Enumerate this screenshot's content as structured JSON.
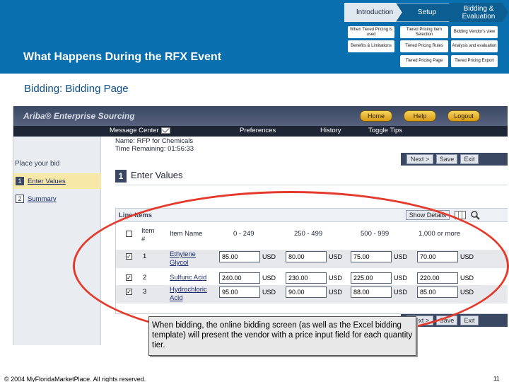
{
  "header": {
    "title": "What Happens During the RFX Event",
    "nav": {
      "stages": [
        {
          "label": "Introduction"
        },
        {
          "label": "Setup"
        },
        {
          "label": "Bidding & Evaluation"
        }
      ],
      "sub_items": {
        "introduction": [
          "When Tiered Pricing is used",
          "Benefits & Limitations"
        ],
        "setup": [
          "Tiered Pricing Item Selection",
          "Tiered Pricing Rules",
          "Tiered Pricing Page"
        ],
        "bidding": [
          "Bidding Vendor's view",
          "Analysis and evaluation",
          "Tiered Pricing Export"
        ]
      }
    }
  },
  "subtitle": "Bidding: Bidding Page",
  "app": {
    "logo": "Ariba® Enterprise Sourcing",
    "top_buttons": [
      "Home",
      "Help",
      "Logout"
    ],
    "menu": {
      "message_center": "Message Center",
      "preferences": "Preferences",
      "history": "History",
      "toggle_tips": "Toggle Tips"
    },
    "event_name": "Name: RFP for Chemicals",
    "time_remaining": "Time Remaining: 01:56:33",
    "left_nav": {
      "heading": "Place your bid",
      "steps": [
        {
          "num": "1",
          "label": "Enter Values"
        },
        {
          "num": "2",
          "label": "Summary"
        }
      ]
    },
    "toolbar": {
      "next": "Next >",
      "save": "Save",
      "exit": "Exit"
    },
    "step_header": {
      "num": "1",
      "title": "Enter Values"
    },
    "line_items": {
      "title": "Line Items",
      "show_details": "Show Details",
      "columns": [
        "Item #",
        "Item Name",
        "0 - 249",
        "250 - 499",
        "500 - 999",
        "1,000 or more"
      ],
      "currency": "USD",
      "rows": [
        {
          "num": "1",
          "name": "Ethylene Glycol",
          "prices": [
            "85.00",
            "80.00",
            "75.00",
            "70.00"
          ],
          "checked": true
        },
        {
          "num": "2",
          "name": "Sulfuric Acid",
          "prices": [
            "240.00",
            "230.00",
            "225.00",
            "220.00"
          ],
          "checked": true
        },
        {
          "num": "3",
          "name": "Hydrochloric Acid",
          "prices": [
            "95.00",
            "90.00",
            "88.00",
            "85.00"
          ],
          "checked": true
        }
      ]
    }
  },
  "callout": "When bidding, the online bidding screen (as well as the Excel bidding template) will present the vendor with a price input field for each quantity tier.",
  "footer": "© 2004 MyFloridaMarketPlace. All rights reserved.",
  "page_number": "11",
  "colors": {
    "header_blue": "#0a6fae",
    "highlight_red": "#e33a2c",
    "ariba_navy": "#3b4863"
  }
}
